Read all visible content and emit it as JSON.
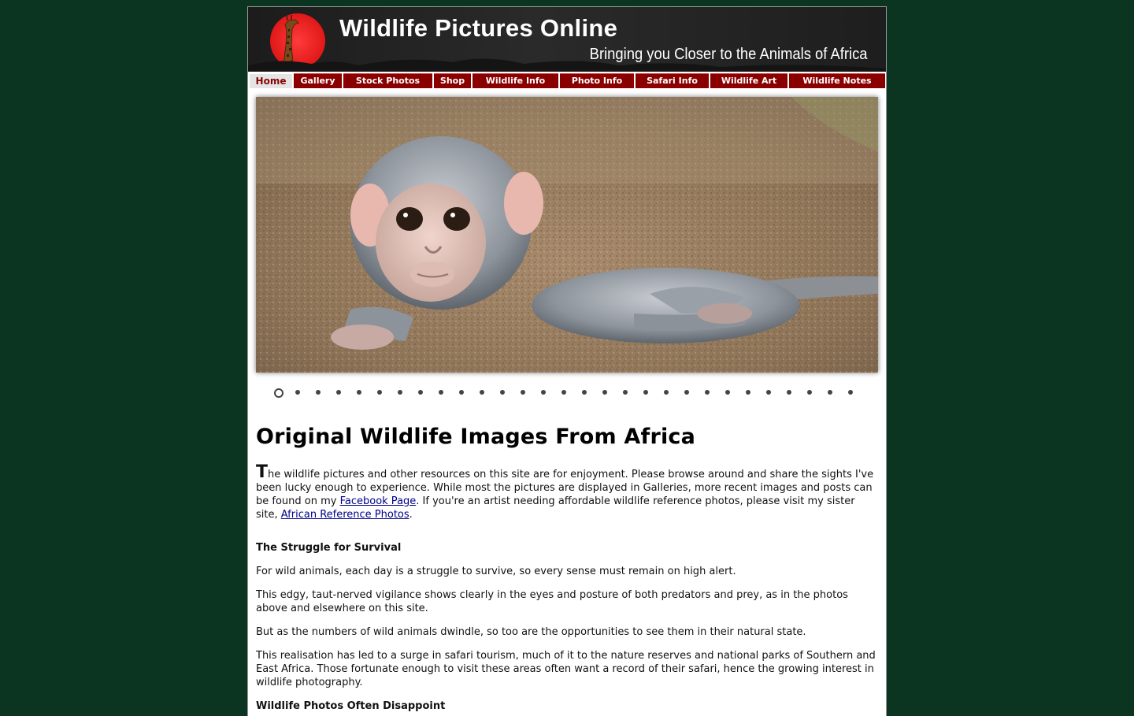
{
  "header": {
    "title": "Wildlife Pictures Online",
    "tagline": "Bringing you Closer to the Animals of Africa",
    "sun_color": "#e01818"
  },
  "nav": {
    "items": [
      {
        "label": "Home",
        "active": true
      },
      {
        "label": "Gallery"
      },
      {
        "label": "Stock Photos"
      },
      {
        "label": "Shop"
      },
      {
        "label": "Wildlife Info"
      },
      {
        "label": "Photo Info"
      },
      {
        "label": "Safari Info"
      },
      {
        "label": "Wildlife Art"
      },
      {
        "label": "Wildlife Notes"
      }
    ],
    "color": "#8a0000"
  },
  "slideshow": {
    "subject": "baby-vervet-monkey",
    "slide_count": 29,
    "active_index": 1
  },
  "main": {
    "title": "Original Wildlife Images From Africa",
    "intro": {
      "dropcap": "T",
      "text_1": "he wildlife pictures and other resources on this site are for enjoyment. Please browse around and share the sights I've been lucky enough to experience. While most the pictures are displayed in Galleries, more recent images and posts can be found on my ",
      "link_1": "Facebook Page",
      "text_2": ". If you're an artist needing affordable wildlife reference photos, please visit my sister site, ",
      "link_2": "African Reference Photos",
      "text_3": "."
    },
    "heading_1": "The Struggle for Survival",
    "para_1": "For wild animals, each day is a struggle to survive, so every sense must remain on high alert.",
    "para_2": "This edgy, taut-nerved vigilance shows clearly in the eyes and posture of both predators and prey, as in the photos above and elsewhere on this site.",
    "para_3": "But as the numbers of wild animals dwindle, so too are the opportunities to see them in their natural state.",
    "para_4": "This realisation has led to a surge in safari tourism, much of it to the nature reserves and national parks of Southern and East Africa. Those fortunate enough to visit these areas often want a record of their safari, hence the growing interest in wildlife photography.",
    "heading_2": "Wildlife Photos Often Disappoint"
  }
}
